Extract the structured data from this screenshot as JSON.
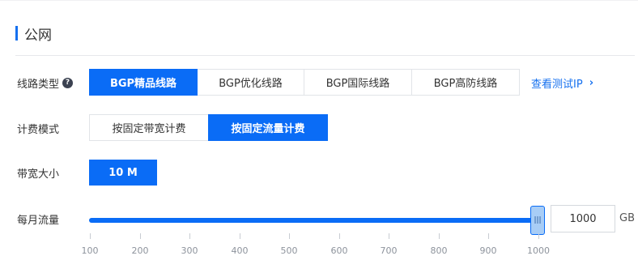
{
  "section": {
    "title": "公网"
  },
  "line_type": {
    "label": "线路类型",
    "help_icon": "help-circle-icon",
    "options": [
      {
        "label": "BGP精品线路",
        "active": true
      },
      {
        "label": "BGP优化线路",
        "active": false
      },
      {
        "label": "BGP国际线路",
        "active": false
      },
      {
        "label": "BGP高防线路",
        "active": false
      }
    ],
    "test_ip_link": "查看测试IP",
    "link_icon": "chevron-right-icon"
  },
  "billing": {
    "label": "计费模式",
    "options": [
      {
        "label": "按固定带宽计费",
        "active": false
      },
      {
        "label": "按固定流量计费",
        "active": true
      }
    ]
  },
  "bandwidth": {
    "label": "带宽大小",
    "value": "10 M"
  },
  "traffic": {
    "label": "每月流量",
    "min": 100,
    "max": 1000,
    "value": 1000,
    "value_text": "1000",
    "unit": "GB",
    "ticks": [
      "100",
      "200",
      "300",
      "400",
      "500",
      "600",
      "700",
      "800",
      "900",
      "1000"
    ],
    "handle_icon": "drag-grip-icon"
  },
  "colors": {
    "accent": "#0a6cf6",
    "link": "#1570ef"
  }
}
